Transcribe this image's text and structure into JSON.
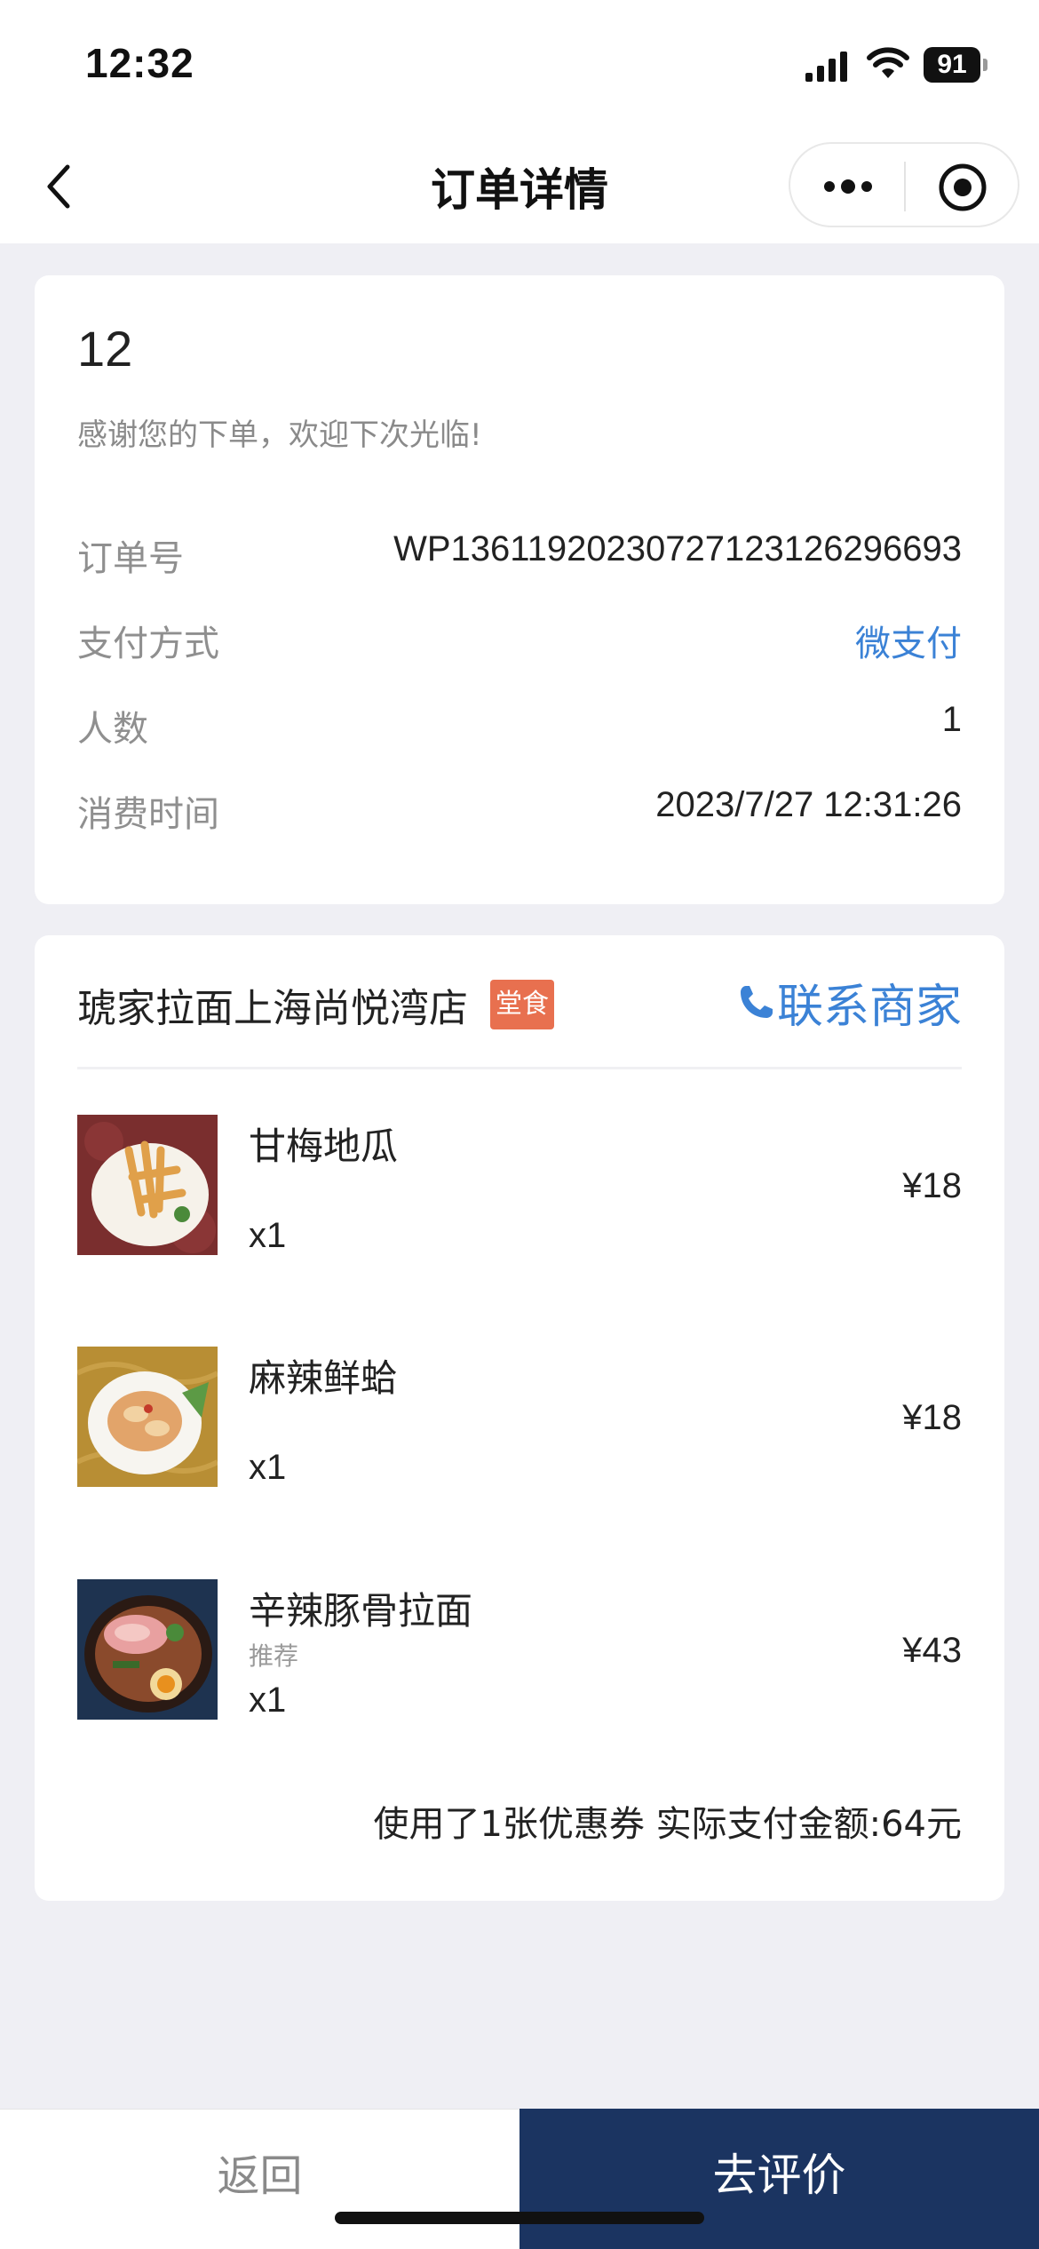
{
  "status_bar": {
    "time": "12:32",
    "battery": "91"
  },
  "nav": {
    "title": "订单详情"
  },
  "order": {
    "table_number": "12",
    "thanks": "感谢您的下单，欢迎下次光临!",
    "rows": [
      {
        "label": "订单号",
        "value": "WP13611920230727123126296693"
      },
      {
        "label": "支付方式",
        "value": "微支付"
      },
      {
        "label": "人数",
        "value": "1"
      },
      {
        "label": "消费时间",
        "value": "2023/7/27 12:31:26"
      }
    ]
  },
  "store": {
    "name": "琥家拉面上海尚悦湾店",
    "badge": "堂食",
    "contact_label": "联系商家"
  },
  "items": [
    {
      "name": "甘梅地瓜",
      "tag": "",
      "qty": "x1",
      "price": "¥18"
    },
    {
      "name": "麻辣鲜蛤",
      "tag": "",
      "qty": "x1",
      "price": "¥18"
    },
    {
      "name": "辛辣豚骨拉面",
      "tag": "推荐",
      "qty": "x1",
      "price": "¥43"
    }
  ],
  "summary": "使用了1张优惠券 实际支付金额:64元",
  "bottom": {
    "back_label": "返回",
    "review_label": "去评价"
  },
  "colors": {
    "accent_blue": "#3b82d6",
    "badge_orange": "#e8704f",
    "primary_navy": "#1b3461"
  }
}
